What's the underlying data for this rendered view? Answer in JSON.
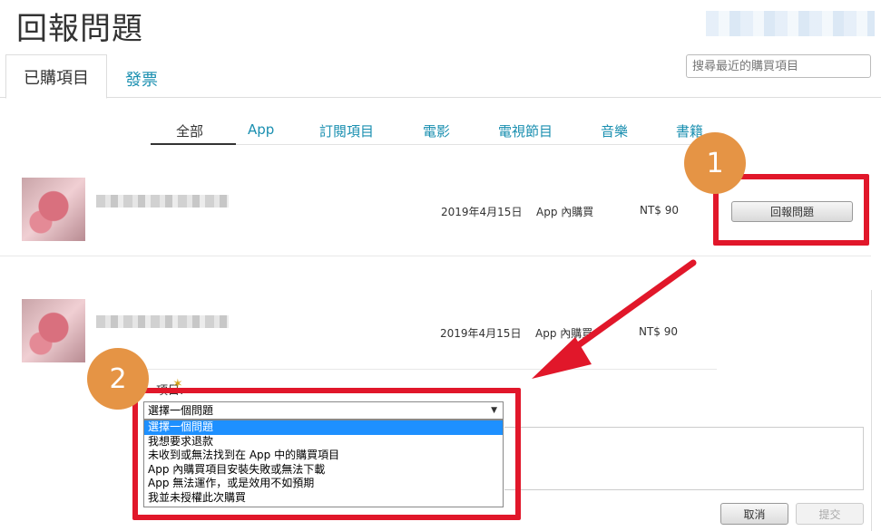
{
  "page": {
    "title": "回報問題"
  },
  "search": {
    "placeholder": "搜尋最近的購買項目"
  },
  "tabs": [
    {
      "label": "已購項目"
    },
    {
      "label": "發票"
    }
  ],
  "filters": [
    "全部",
    "App",
    "訂閱項目",
    "電影",
    "電視節目",
    "音樂",
    "書籍"
  ],
  "purchases": [
    {
      "date": "2019年4月15日",
      "type": "App 內購買",
      "price": "NT$ 90",
      "action": "回報問題"
    },
    {
      "date": "2019年4月15日",
      "type": "App 內購買",
      "price": "NT$ 90"
    }
  ],
  "report_form": {
    "reason_label_fragment": "項目:",
    "select_value": "選擇一個問題",
    "options": [
      "選擇一個問題",
      "我想要求退款",
      "未收到或無法找到在 App 中的購買項目",
      "App 內購買項目安裝失敗或無法下載",
      "App 無法運作，或是效用不如預期",
      "我並未授權此次購買"
    ],
    "cancel_label": "取消",
    "submit_label": "提交"
  },
  "annotations": {
    "step1": "1",
    "step2": "2",
    "highlight_color": "#e1172a",
    "badge_color": "#e59445"
  }
}
